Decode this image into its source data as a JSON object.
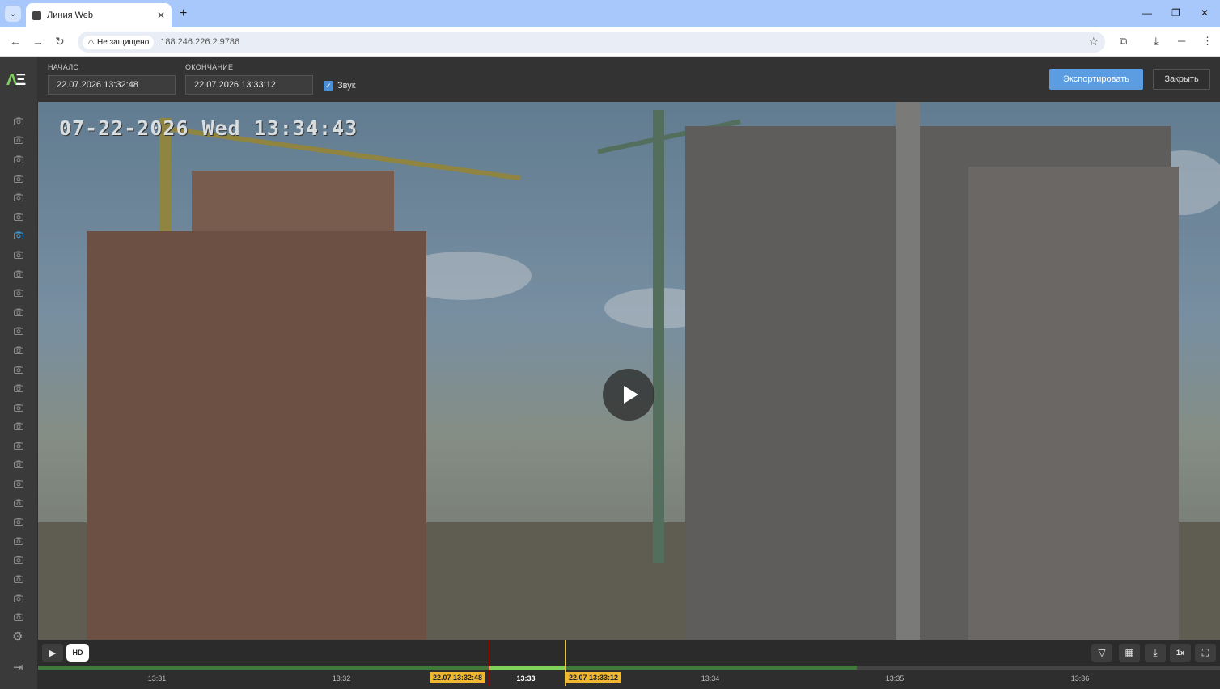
{
  "browser": {
    "tab_title": "Линия Web",
    "new_tab": "+",
    "insecure_label": "Не защищено",
    "url": "188.246.226.2:9786",
    "window_controls": [
      "—",
      "❐",
      "✕"
    ]
  },
  "app": {
    "logo": "AE",
    "start_label": "НАЧАЛО",
    "start_value": "22.07.2026 13:32:48",
    "end_label": "ОКОНЧАНИЕ",
    "end_value": "22.07.2026 13:33:12",
    "sound_label": "Звук",
    "sound_checked": true,
    "export_button": "Экспортировать",
    "close_button": "Закрыть",
    "camera_count": 27,
    "active_camera_index": 6
  },
  "video": {
    "osd_timestamp": "07-22-2026 Wed 13:34:43"
  },
  "player": {
    "hd_label": "HD",
    "speed_label": "1x"
  },
  "timeline": {
    "ticks": [
      "13:31",
      "13:32",
      "13:33",
      "13:34",
      "13:35",
      "13:36"
    ],
    "current_tick": "13:33",
    "start_marker": "22.07 13:32:48",
    "end_marker": "22.07 13:33:12"
  },
  "colors": {
    "accent": "#5b9de0",
    "timeline_selected": "#7fd35a",
    "marker": "#f0b830"
  }
}
